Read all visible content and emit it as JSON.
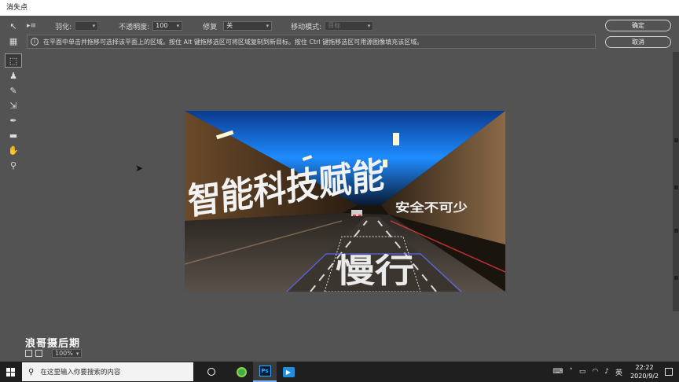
{
  "window": {
    "title": "消失点"
  },
  "options": {
    "feather_label": "羽化:",
    "feather_value": "",
    "opacity_label": "不透明度:",
    "opacity_value": "100",
    "heal_label": "修复",
    "heal_value": "关",
    "move_mode_label": "移动模式:",
    "move_mode_value": "目标"
  },
  "info": {
    "message": "在平面中单击并拖移可选择该平面上的区域。按住 Alt 键拖移选区可将区域复制到新目标。按住 Ctrl 键拖移选区可用源图像填充该区域。"
  },
  "buttons": {
    "ok": "确定",
    "cancel": "取消"
  },
  "canvas": {
    "headline": "智能科技赋能",
    "tagline": "安全不可少",
    "road_text": "慢行"
  },
  "status": {
    "zoom_value": "100%"
  },
  "watermark": {
    "text": "浪哥摄后期"
  },
  "taskbar": {
    "search_placeholder": "在这里输入你要搜索的内容",
    "time": "22:22",
    "date": "2020/9/2"
  },
  "icons": {
    "tools": [
      "edit-plane-icon",
      "create-plane-icon",
      "marquee-icon",
      "stamp-icon",
      "brush-icon",
      "transform-icon",
      "eyedropper-icon",
      "measure-icon",
      "hand-icon",
      "zoom-icon"
    ]
  },
  "colors": {
    "panel": "#535353",
    "tunnel_blue": "#1e8cff",
    "taskbar": "#1f1f1f"
  }
}
